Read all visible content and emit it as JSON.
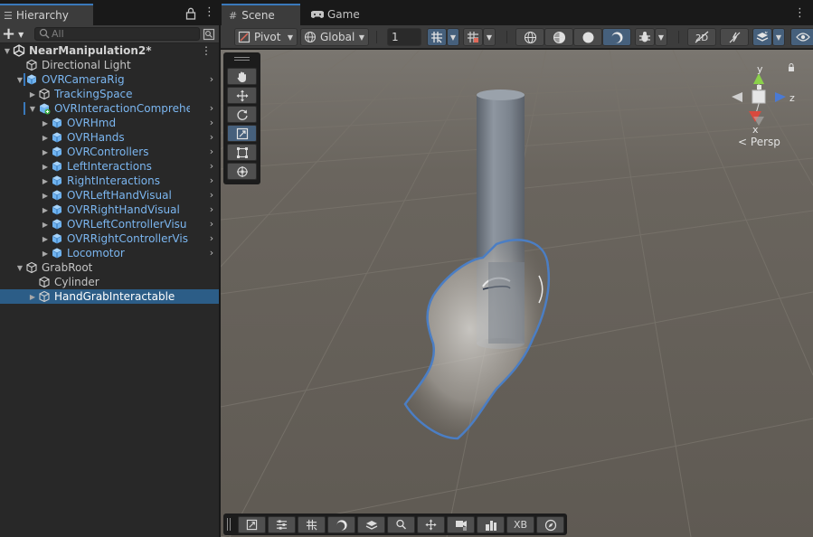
{
  "hierarchy": {
    "tab_label": "Hierarchy",
    "search_placeholder": "All",
    "items": [
      {
        "label": "NearManipulation2*",
        "depth": 0,
        "foldout": "down",
        "icon": "unity-scene-icon",
        "kind": "scene"
      },
      {
        "label": "Directional Light",
        "depth": 1,
        "foldout": "none",
        "icon": "cube-outline-icon",
        "kind": "plain"
      },
      {
        "label": "OVRCameraRig",
        "depth": 1,
        "foldout": "down",
        "icon": "prefab-cube-icon",
        "kind": "prefab",
        "chevron": true,
        "mark": true
      },
      {
        "label": "TrackingSpace",
        "depth": 2,
        "foldout": "right",
        "icon": "cube-outline-icon",
        "kind": "prefab"
      },
      {
        "label": "OVRInteractionComprehe",
        "depth": 2,
        "foldout": "down",
        "icon": "prefab-variant-icon",
        "kind": "prefab",
        "chevron": true,
        "mark": true
      },
      {
        "label": "OVRHmd",
        "depth": 3,
        "foldout": "right",
        "icon": "prefab-cube-icon",
        "kind": "prefab",
        "chevron": true
      },
      {
        "label": "OVRHands",
        "depth": 3,
        "foldout": "right",
        "icon": "prefab-cube-icon",
        "kind": "prefab",
        "chevron": true
      },
      {
        "label": "OVRControllers",
        "depth": 3,
        "foldout": "right",
        "icon": "prefab-cube-icon",
        "kind": "prefab",
        "chevron": true
      },
      {
        "label": "LeftInteractions",
        "depth": 3,
        "foldout": "right",
        "icon": "prefab-cube-icon",
        "kind": "prefab",
        "chevron": true
      },
      {
        "label": "RightInteractions",
        "depth": 3,
        "foldout": "right",
        "icon": "prefab-cube-icon",
        "kind": "prefab",
        "chevron": true
      },
      {
        "label": "OVRLeftHandVisual",
        "depth": 3,
        "foldout": "right",
        "icon": "prefab-cube-icon",
        "kind": "prefab",
        "chevron": true
      },
      {
        "label": "OVRRightHandVisual",
        "depth": 3,
        "foldout": "right",
        "icon": "prefab-cube-icon",
        "kind": "prefab",
        "chevron": true
      },
      {
        "label": "OVRLeftControllerVisu",
        "depth": 3,
        "foldout": "right",
        "icon": "prefab-cube-icon",
        "kind": "prefab",
        "chevron": true
      },
      {
        "label": "OVRRightControllerVis",
        "depth": 3,
        "foldout": "right",
        "icon": "prefab-cube-icon",
        "kind": "prefab",
        "chevron": true
      },
      {
        "label": "Locomotor",
        "depth": 3,
        "foldout": "right",
        "icon": "prefab-cube-icon",
        "kind": "prefab",
        "chevron": true
      },
      {
        "label": "GrabRoot",
        "depth": 1,
        "foldout": "down",
        "icon": "cube-outline-icon",
        "kind": "plain"
      },
      {
        "label": "Cylinder",
        "depth": 2,
        "foldout": "none",
        "icon": "cube-outline-icon",
        "kind": "plain"
      },
      {
        "label": "HandGrabInteractable",
        "depth": 2,
        "foldout": "right",
        "icon": "cube-outline-icon",
        "kind": "plain",
        "selected": true
      }
    ]
  },
  "scene": {
    "tabs": [
      {
        "label": "Scene",
        "icon": "grid-hash-icon",
        "active": true
      },
      {
        "label": "Game",
        "icon": "gamepad-icon",
        "active": false
      }
    ],
    "toolbar": {
      "pivot_label": "Pivot",
      "global_label": "Global",
      "grid_snap_value": "1"
    },
    "gizmo": {
      "y_label": "y",
      "z_label": "z",
      "x_label": "x",
      "projection_label": "Persp"
    },
    "bottom_toolbar": {
      "xb_label": "XB"
    }
  },
  "colors": {
    "accent": "#3a79bb",
    "prefab_text": "#7bb6f0",
    "selection": "#2c5d87",
    "viewport_ground": "#656058",
    "hand_outline": "#4b7ec4"
  }
}
